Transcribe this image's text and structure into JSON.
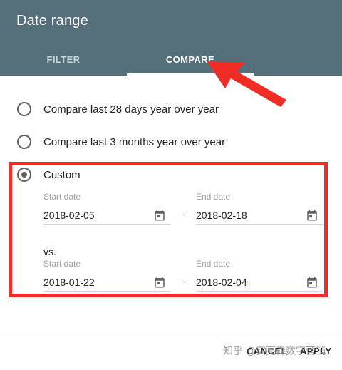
{
  "dialog": {
    "title": "Date range",
    "tabs": [
      {
        "label": "FILTER",
        "active": false
      },
      {
        "label": "COMPARE",
        "active": true
      }
    ],
    "header_color": "#546e7a"
  },
  "options": [
    {
      "label": "Compare last 28 days year over year",
      "selected": false
    },
    {
      "label": "Compare last 3 months year over year",
      "selected": false
    },
    {
      "label": "Custom",
      "selected": true
    }
  ],
  "custom": {
    "range1": {
      "start_label": "Start date",
      "start_value": "2018-02-05",
      "end_label": "End date",
      "end_value": "2018-02-18"
    },
    "separator": "-",
    "vs_label": "vs.",
    "range2": {
      "start_label": "Start date",
      "start_value": "2018-01-22",
      "end_label": "End date",
      "end_value": "2018-02-04"
    }
  },
  "footer": {
    "cancel_label": "CANCEL",
    "apply_label": "APPLY"
  },
  "watermark": "知乎 @实亮森数字营销",
  "annotation": {
    "highlight_color": "#f02d25",
    "arrow_color": "#f02d25",
    "icon": "arrow-icon"
  }
}
